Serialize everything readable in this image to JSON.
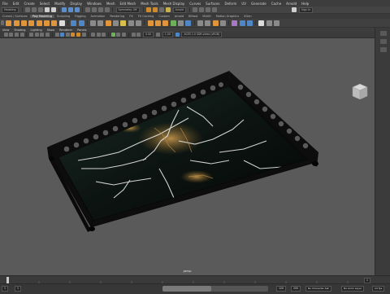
{
  "menubar": {
    "items": [
      "File",
      "Edit",
      "Create",
      "Select",
      "Modify",
      "Display",
      "Windows",
      "Mesh",
      "Edit Mesh",
      "Mesh Tools",
      "Mesh Display",
      "Curves",
      "Surfaces",
      "Deform",
      "UV",
      "Generate",
      "Cache",
      "Arnold",
      "Help"
    ]
  },
  "statusline": {
    "mode": "Modeling",
    "renderer": "Arnold",
    "symmetry": "Symmetry: Off",
    "sign_in": "Sign In"
  },
  "shelf": {
    "tabs": [
      "Curves / Surfaces",
      "Poly Modeling",
      "Sculpting",
      "Rigging",
      "Animation",
      "Rendering",
      "FX",
      "FX Caching",
      "Custom",
      "Arnold",
      "Bifrost",
      "MASH",
      "Motion Graphics",
      "XGen"
    ],
    "active_tab": "Poly Modeling"
  },
  "panel": {
    "menus": [
      "View",
      "Shading",
      "Lighting",
      "Show",
      "Renderer",
      "Panels"
    ],
    "value_a": "0.00",
    "value_b": "1.00",
    "colorspace": "ACES 1.0 SDR-video (sRGB)"
  },
  "viewport": {
    "camera_label": "persp",
    "background": "#5a5a5a",
    "object": "Marble tray with lattice rail"
  },
  "timeline": {
    "start": "1",
    "end": "120",
    "current": "1"
  },
  "rangebar": {
    "range_start": "1",
    "range_end": "120",
    "anim_end": "200",
    "char_set": "No Character Set",
    "anim_layer": "No Anim Layer",
    "fps": "24 fps"
  }
}
